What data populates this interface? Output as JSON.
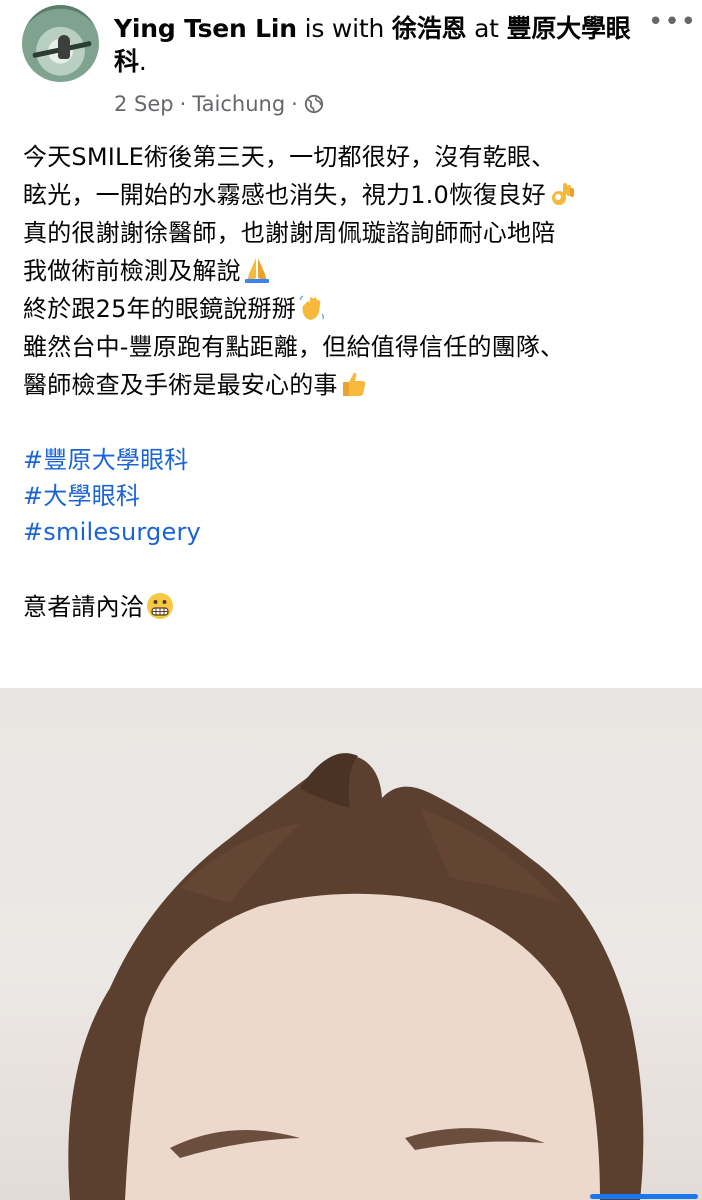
{
  "post": {
    "author": "Ying Tsen Lin",
    "with_text": "is with",
    "tagged": "徐浩恩",
    "at_text": "at",
    "location_tag": "豐原大學眼科",
    "period": ".",
    "date": "2 Sep",
    "place": "Taichung",
    "sep": "·",
    "more_label": "•••"
  },
  "body": {
    "lines": [
      "今天SMILE術後第三天，一切都很好，沒有乾眼、",
      "眩光，一開始的水霧感也消失，視力1.0恢復良好",
      "真的很謝謝徐醫師，也謝謝周佩璇諮詢師耐心地陪",
      "我做術前檢測及解說",
      "終於跟25年的眼鏡說掰掰",
      "雖然台中-豐原跑有點距離，但給值得信任的團隊、",
      "醫師檢查及手術是最安心的事"
    ],
    "hashtags": [
      "#豐原大學眼科",
      "#大學眼科",
      "#smilesurgery"
    ],
    "closing": "意者請內洽"
  },
  "icons": {
    "globe": "globe-icon",
    "more": "more-options-icon",
    "ok_hand": "ok-hand-emoji",
    "pray": "folded-hands-emoji",
    "wave": "waving-hand-emoji",
    "thumbs": "thumbs-up-emoji",
    "grimace": "grimacing-face-emoji"
  },
  "colors": {
    "hashtag": "#1b64d6",
    "meta": "#65676b",
    "text": "#050505"
  }
}
